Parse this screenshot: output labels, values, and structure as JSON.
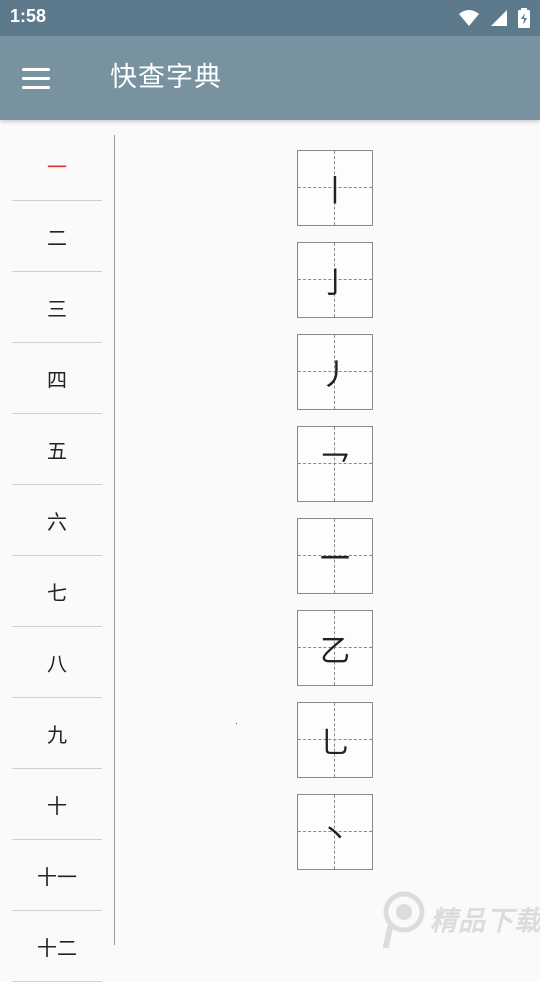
{
  "status_bar": {
    "time": "1:58"
  },
  "app_bar": {
    "title": "快查字典"
  },
  "sidebar": {
    "items": [
      {
        "label": "一"
      },
      {
        "label": "二"
      },
      {
        "label": "三"
      },
      {
        "label": "四"
      },
      {
        "label": "五"
      },
      {
        "label": "六"
      },
      {
        "label": "七"
      },
      {
        "label": "八"
      },
      {
        "label": "九"
      },
      {
        "label": "十"
      },
      {
        "label": "十一"
      },
      {
        "label": "十二"
      }
    ],
    "selected_label": "一"
  },
  "strokes": [
    {
      "char": "丨"
    },
    {
      "char": "亅"
    },
    {
      "char": "丿"
    },
    {
      "char": "乛"
    },
    {
      "char": "一"
    },
    {
      "char": "乙"
    },
    {
      "char": "乚"
    },
    {
      "char": "丶"
    }
  ],
  "watermark": {
    "text": "精品下载"
  },
  "colors": {
    "status_bar": "#5c7a8b",
    "app_bar": "#7992a0",
    "active_item": "#d9322e",
    "background": "#fafafa"
  }
}
